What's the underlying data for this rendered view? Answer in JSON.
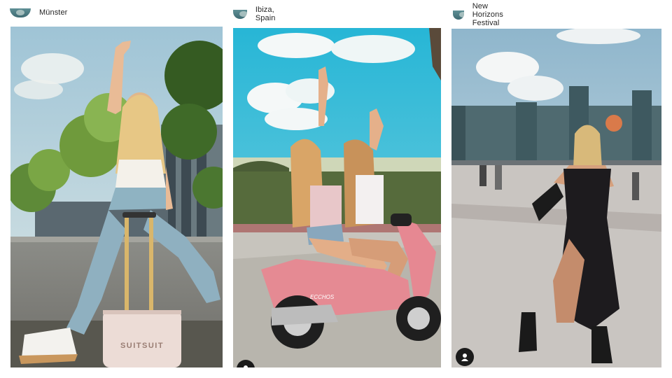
{
  "posts": [
    {
      "location": "Münster",
      "photo_subject": "woman-with-suitcase-photo",
      "suitcase_brand": "SUITSUIT"
    },
    {
      "location": "Ibiza, Spain",
      "photo_subject": "women-on-scooter-photo",
      "scooter_text": "ECCHOS"
    },
    {
      "location": "New Horizons Festival",
      "photo_subject": "woman-at-festival-photo"
    }
  ],
  "icons": {
    "avatar": "profile-avatar",
    "tagged_user": "user-icon"
  }
}
